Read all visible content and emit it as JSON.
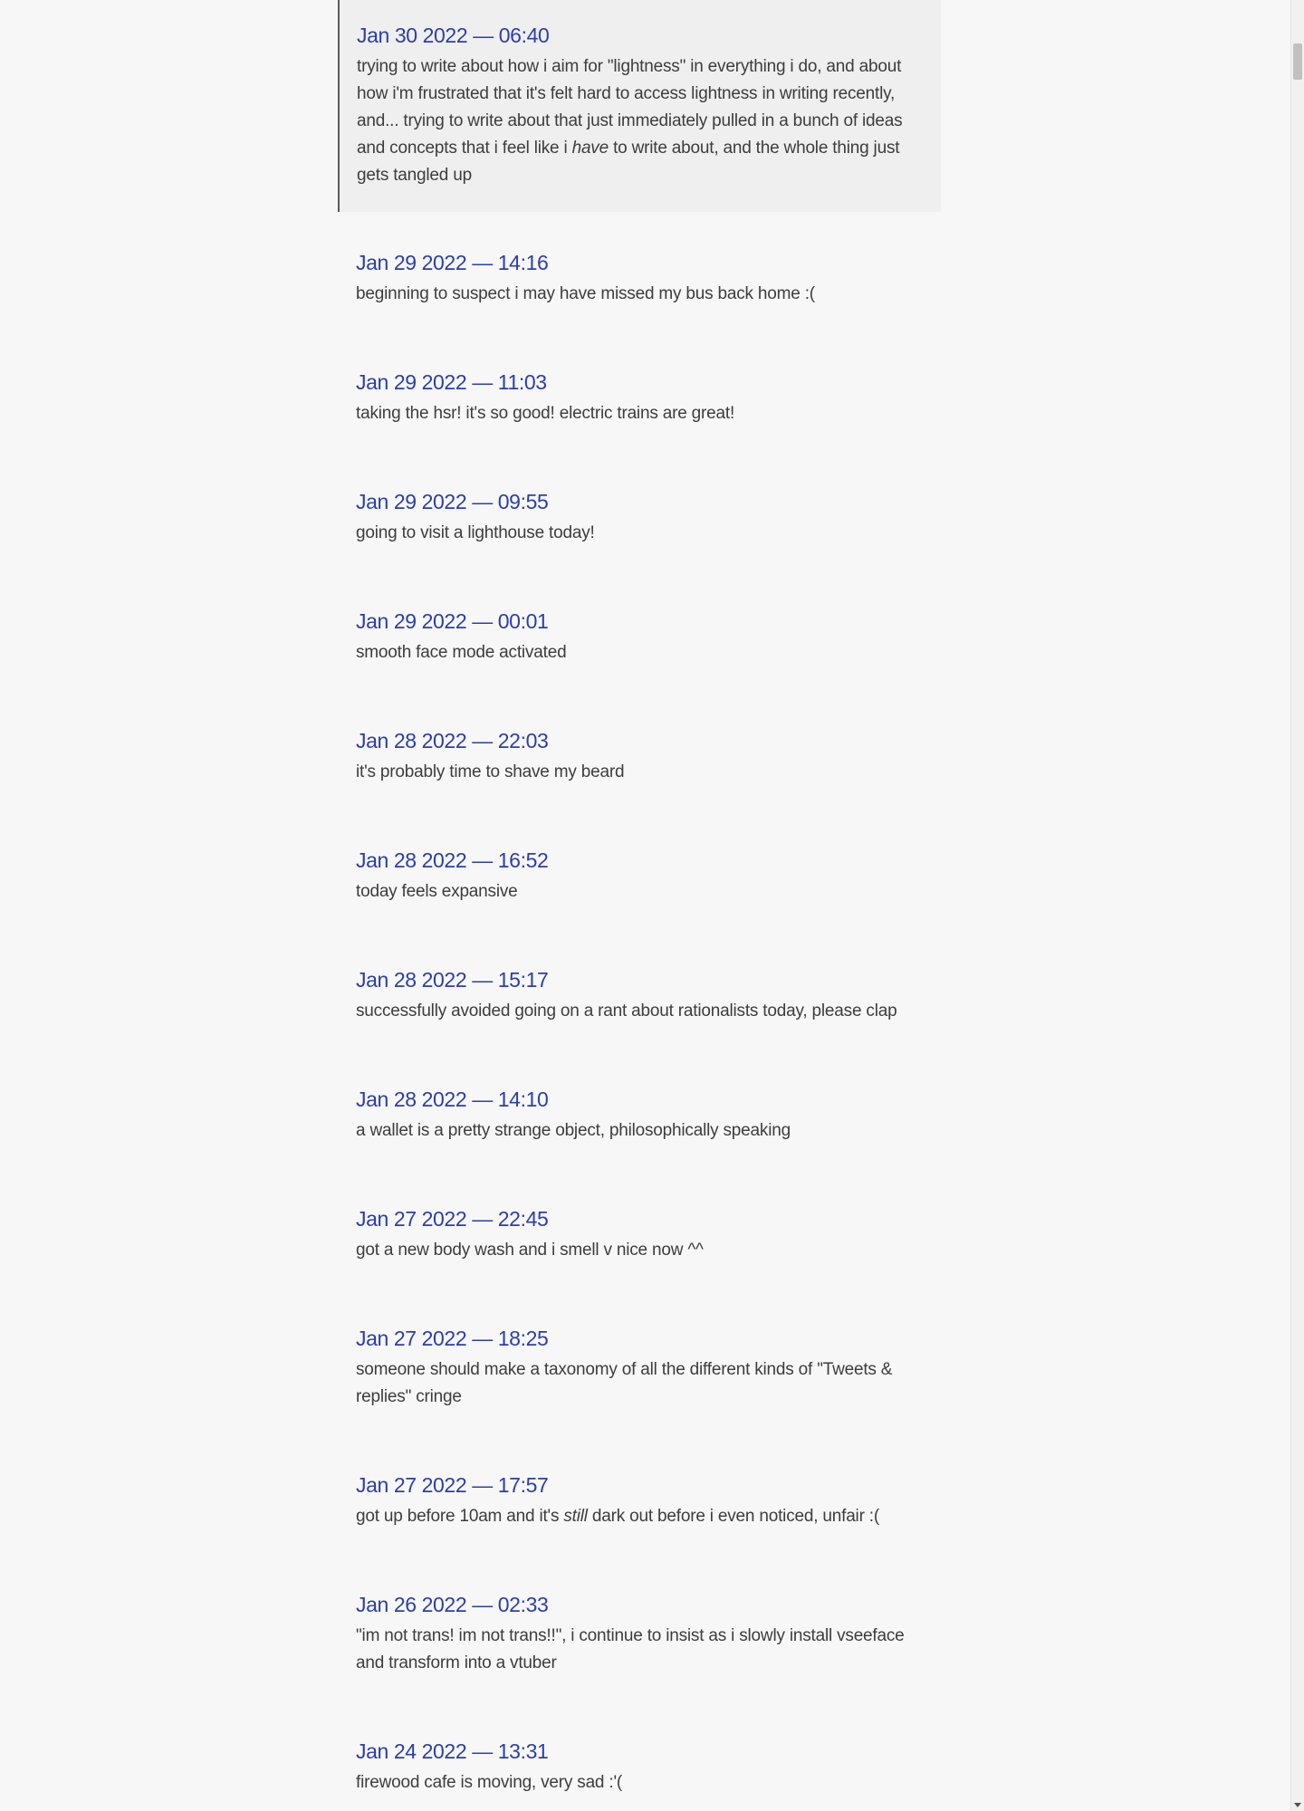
{
  "entries": [
    {
      "time": "Jan 30 2022 — 06:40",
      "text_parts": [
        "trying to write about how i aim for \"lightness\" in everything i do, and about how i'm frustrated that it's felt hard to access lightness in writing recently, and... trying to write about that just immediately pulled in a bunch of ideas and concepts that i feel like i ",
        "have",
        " to write about, and the whole thing just gets tangled up"
      ]
    },
    {
      "time": "Jan 29 2022 — 14:16",
      "text": "beginning to suspect i may have missed my bus back home :("
    },
    {
      "time": "Jan 29 2022 — 11:03",
      "text": "taking the hsr! it's so good! electric trains are great!"
    },
    {
      "time": "Jan 29 2022 — 09:55",
      "text": "going to visit a lighthouse today!"
    },
    {
      "time": "Jan 29 2022 — 00:01",
      "text": "smooth face mode activated"
    },
    {
      "time": "Jan 28 2022 — 22:03",
      "text": "it's probably time to shave my beard"
    },
    {
      "time": "Jan 28 2022 — 16:52",
      "text": "today feels expansive"
    },
    {
      "time": "Jan 28 2022 — 15:17",
      "text": "successfully avoided going on a rant about rationalists today, please clap"
    },
    {
      "time": "Jan 28 2022 — 14:10",
      "text": "a wallet is a pretty strange object, philosophically speaking"
    },
    {
      "time": "Jan 27 2022 — 22:45",
      "text": "got a new body wash and i smell v nice now ^^"
    },
    {
      "time": "Jan 27 2022 — 18:25",
      "text": "someone should make a taxonomy of all the different kinds of \"Tweets & replies\" cringe"
    },
    {
      "time": "Jan 27 2022 — 17:57",
      "text_parts": [
        "got up before 10am and it's ",
        "still",
        " dark out before i even noticed, unfair :("
      ]
    },
    {
      "time": "Jan 26 2022 — 02:33",
      "text": "\"im not trans! im not trans!!\", i continue to insist as i slowly install vseeface and transform into a vtuber"
    },
    {
      "time": "Jan 24 2022 — 13:31",
      "text": "firewood cafe is moving, very sad :'("
    }
  ]
}
